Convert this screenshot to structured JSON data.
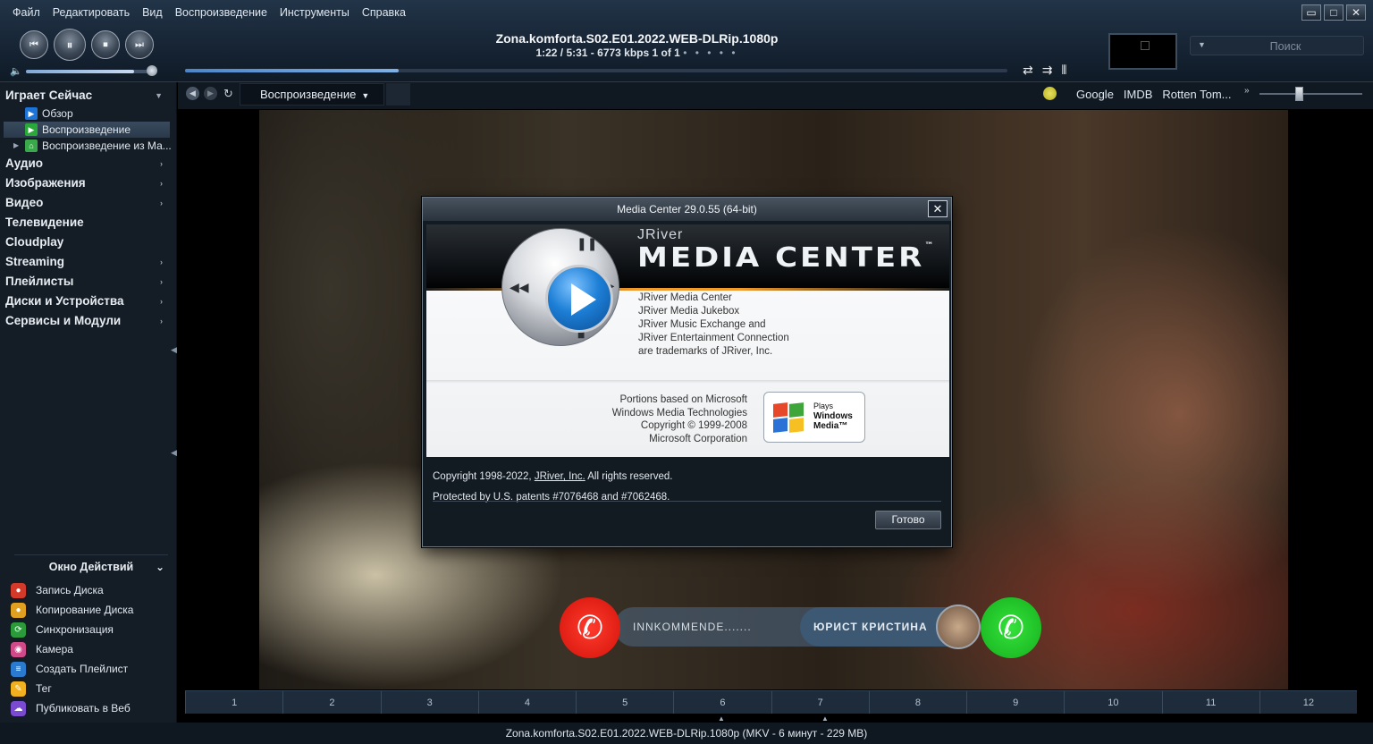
{
  "menubar": {
    "items": [
      "Файл",
      "Редактировать",
      "Вид",
      "Воспроизведение",
      "Инструменты",
      "Справка"
    ]
  },
  "window_controls": {
    "minimize": "▭",
    "maximize": "□",
    "close": "✕"
  },
  "transport": {
    "prev": "⏮",
    "pause": "⏸",
    "stop": "⏹",
    "next": "⏭",
    "volume_level": 0.85
  },
  "now_playing": {
    "title": "Zona.komforta.S02.E01.2022.WEB-DLRip.1080p",
    "stats": "1:22 / 5:31 - 6773 kbps   1 of 1",
    "dots": "• • • • •",
    "progress": 0.26
  },
  "mode_icons": [
    "⇄",
    "⇉",
    "⫴"
  ],
  "search": {
    "placeholder": "Поиск",
    "dropdown": "▼"
  },
  "sidebar": {
    "playing_now": "Играет Сейчас",
    "playing_sub": [
      {
        "label": "Обзор",
        "icon": "overview-icon",
        "color": "#1e74d6"
      },
      {
        "label": "Воспроизведение",
        "icon": "play-icon",
        "color": "#2aa83a"
      },
      {
        "label": "Воспроизведение из Ма...",
        "icon": "network-icon",
        "color": "#3aa84a"
      }
    ],
    "sections": [
      {
        "label": "Аудио",
        "arrow": "›"
      },
      {
        "label": "Изображения",
        "arrow": "›"
      },
      {
        "label": "Видео",
        "arrow": "›"
      },
      {
        "label": "Телевидение",
        "arrow": ""
      },
      {
        "label": "Cloudplay",
        "arrow": ""
      },
      {
        "label": "Streaming",
        "arrow": "›"
      },
      {
        "label": "Плейлисты",
        "arrow": "›"
      },
      {
        "label": "Диски и Устройства",
        "arrow": "›"
      },
      {
        "label": "Сервисы и Модули",
        "arrow": "›"
      }
    ]
  },
  "actions": {
    "header": "Окно Действий",
    "items": [
      {
        "label": "Запись Диска",
        "icon": "burn-disc-icon",
        "color": "#d43a2a"
      },
      {
        "label": "Копирование Диска",
        "icon": "copy-disc-icon",
        "color": "#e0a020"
      },
      {
        "label": "Синхронизация",
        "icon": "sync-icon",
        "color": "#2a9a3a"
      },
      {
        "label": "Камера",
        "icon": "camera-icon",
        "color": "#d04a8a"
      },
      {
        "label": "Создать Плейлист",
        "icon": "playlist-icon",
        "color": "#2a7ad0"
      },
      {
        "label": "Тег",
        "icon": "tag-icon",
        "color": "#f0b020"
      },
      {
        "label": "Публиковать в Веб",
        "icon": "publish-web-icon",
        "color": "#7a4ad0"
      }
    ]
  },
  "view_toolbar": {
    "tab_label": "Воспроизведение",
    "caret": "▼",
    "links": [
      "Google",
      "IMDB",
      "Rotten Tom..."
    ],
    "more": "»"
  },
  "call_overlay": {
    "incoming": "INNKOMMENDE.......",
    "caller": "ЮРИСТ КРИСТИНА",
    "phone_glyph": "✆"
  },
  "dialog": {
    "title": "Media Center 29.0.55 (64-bit)",
    "close": "✕",
    "brand_small": "JRiver",
    "brand_big": "MEDIA CENTER",
    "tm": "™",
    "trademarks": [
      "JRiver Media Center",
      "JRiver Media Jukebox",
      "JRiver Music Exchange and",
      "JRiver Entertainment Connection",
      "are trademarks of JRiver, Inc."
    ],
    "portions": [
      "Portions based on Microsoft",
      "Windows Media Technologies",
      "Copyright © 1999-2008",
      "Microsoft Corporation"
    ],
    "wm_badge": {
      "plays": "Plays",
      "windows": "Windows",
      "media": "Media™"
    },
    "copyright_prefix": "Copyright 1998-2022, ",
    "copyright_link": "JRiver, Inc.",
    "copyright_suffix": "  All rights reserved.",
    "patents": "Protected by U.S. patents #7076468 and #7062468.",
    "ok_label": "Готово"
  },
  "chapters": [
    "1",
    "2",
    "3",
    "4",
    "5",
    "6",
    "7",
    "8",
    "9",
    "10",
    "11",
    "12"
  ],
  "footer": "Zona.komforta.S02.E01.2022.WEB-DLRip.1080p (MKV - 6 минут - 229 MB)"
}
